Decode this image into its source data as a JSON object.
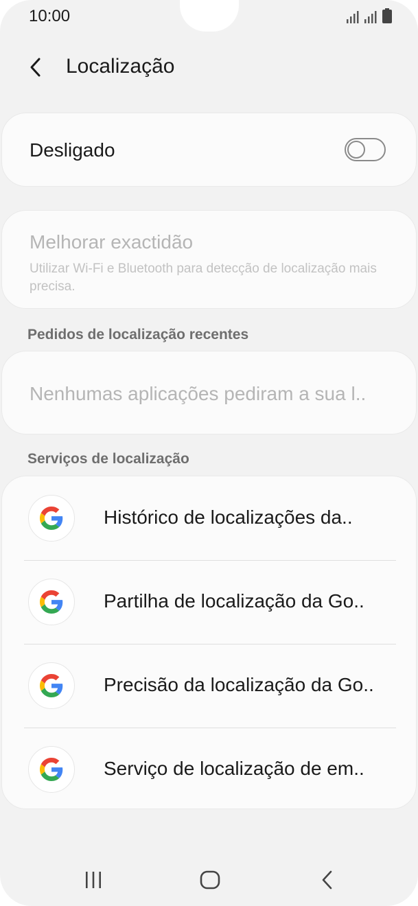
{
  "status_bar": {
    "time": "10:00"
  },
  "header": {
    "title": "Localização"
  },
  "location_toggle": {
    "label": "Desligado",
    "state": "off"
  },
  "accuracy": {
    "title": "Melhorar exactidão",
    "description": "Utilizar Wi-Fi e Bluetooth para detecção de localização mais precisa."
  },
  "recent_requests": {
    "header": "Pedidos de localização recentes",
    "empty_text": "Nenhumas aplicações pediram a sua l.."
  },
  "services": {
    "header": "Serviços de localização",
    "items": [
      {
        "label": "Histórico de localizações da..",
        "icon": "google-icon"
      },
      {
        "label": "Partilha de localização da Go..",
        "icon": "google-icon"
      },
      {
        "label": "Precisão da localização da Go..",
        "icon": "google-icon"
      },
      {
        "label": "Serviço de localização de em..",
        "icon": "google-icon"
      }
    ]
  },
  "colors": {
    "background": "#f2f2f2",
    "card": "#fbfbfb",
    "text_primary": "#1a1a1a",
    "text_disabled": "#b5b5b5",
    "google_blue": "#4285F4",
    "google_red": "#EA4335",
    "google_yellow": "#FBBC05",
    "google_green": "#34A853"
  }
}
